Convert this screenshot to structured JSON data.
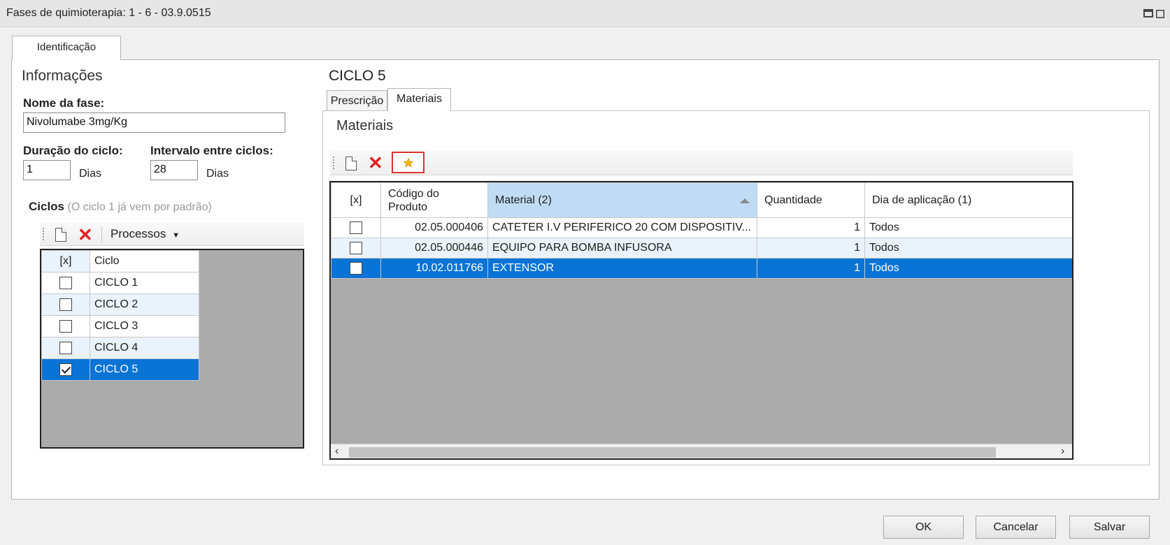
{
  "window": {
    "title": "Fases de quimioterapia: 1 - 6 - 03.9.0515"
  },
  "outer_tab": {
    "label": "Identificação"
  },
  "info": {
    "heading": "Informações",
    "nome_label": "Nome da fase:",
    "nome_value": "Nivolumabe 3mg/Kg",
    "duracao_label": "Duração do ciclo:",
    "duracao_value": "1",
    "duracao_unit": "Dias",
    "intervalo_label": "Intervalo entre ciclos:",
    "intervalo_value": "28",
    "intervalo_unit": "Dias"
  },
  "ciclos": {
    "label": "Ciclos",
    "hint": "(O ciclo 1 já vem por padrão)",
    "processos_label": "Processos",
    "columns": [
      "[x]",
      "Ciclo"
    ],
    "rows": [
      {
        "checked": false,
        "name": "CICLO 1"
      },
      {
        "checked": false,
        "name": "CICLO 2"
      },
      {
        "checked": false,
        "name": "CICLO 3"
      },
      {
        "checked": false,
        "name": "CICLO 4"
      },
      {
        "checked": true,
        "name": "CICLO 5"
      }
    ]
  },
  "ciclo_detail": {
    "heading": "CICLO 5",
    "tabs": [
      "Prescrição",
      "Materiais"
    ],
    "active_tab": "Materiais",
    "panel_heading": "Materiais",
    "columns": {
      "check": "[x]",
      "codigo": "Código do Produto",
      "codigo_line1": "Código do",
      "codigo_line2": "Produto",
      "material": "Material (2)",
      "quantidade": "Quantidade",
      "dia": "Dia de aplicação (1)"
    },
    "rows": [
      {
        "checked": false,
        "codigo": "02.05.000406",
        "material": "CATETER I.V PERIFERICO 20 COM DISPOSITIV...",
        "quantidade": "1",
        "dia": "Todos"
      },
      {
        "checked": false,
        "codigo": "02.05.000446",
        "material": "EQUIPO PARA BOMBA INFUSORA",
        "quantidade": "1",
        "dia": "Todos"
      },
      {
        "checked": false,
        "codigo": "10.02.011766",
        "material": "EXTENSOR",
        "quantidade": "1",
        "dia": "Todos"
      }
    ]
  },
  "footer": {
    "ok": "OK",
    "cancel": "Cancelar",
    "save": "Salvar"
  },
  "colors": {
    "selection": "#0a74d6",
    "alt_row": "#eaf3fc",
    "highlight_box": "#e03030",
    "star": "#f2b600"
  },
  "icons": [
    "restore-window-icon",
    "new-document-icon",
    "delete-x-icon",
    "favorite-star-icon",
    "dropdown-caret-icon",
    "sort-ascending-icon",
    "scroll-left-icon",
    "scroll-right-icon"
  ]
}
